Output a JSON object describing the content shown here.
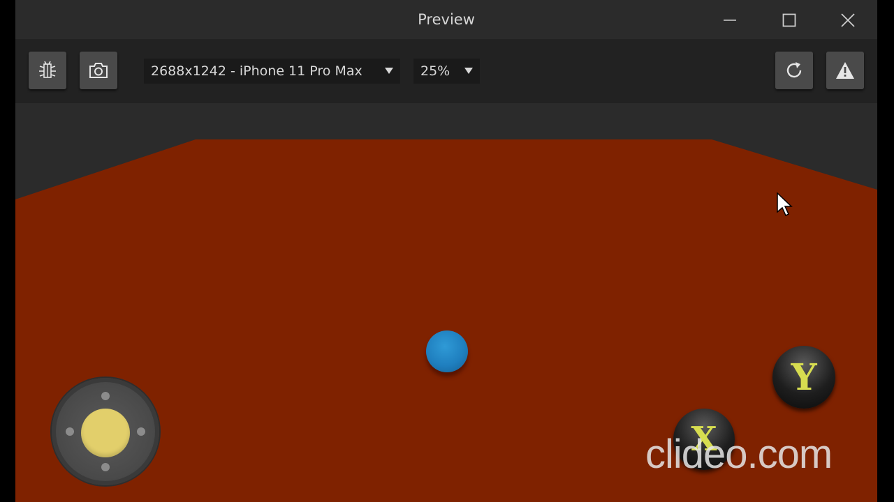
{
  "window": {
    "title": "Preview"
  },
  "toolbar": {
    "debug_icon": "bug-icon",
    "screenshot_icon": "camera-icon",
    "resolution_value": "2688x1242 - iPhone 11 Pro Max",
    "zoom_value": "25%",
    "refresh_icon": "refresh-icon",
    "warning_icon": "warning-icon"
  },
  "game": {
    "floor_color": "#7f2200",
    "background_color": "#2b2b2b",
    "ball_color": "#1f7fbf",
    "joystick_knob_color": "#e2cf6b",
    "button_y_label": "Y",
    "button_x_label": "X"
  },
  "watermark": {
    "text": "clideo.com"
  }
}
